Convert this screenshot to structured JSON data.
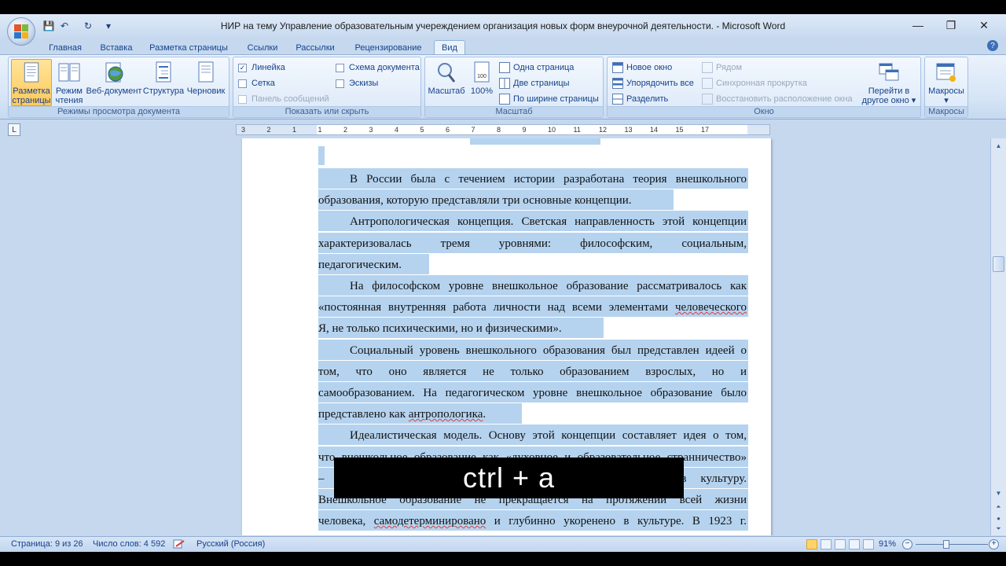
{
  "window": {
    "title": "НИР на тему Управление образовательным учереждением организация новых форм внеурочной деятельности. - Microsoft Word",
    "minimize_glyph": "—",
    "restore_glyph": "❐",
    "close_glyph": "✕"
  },
  "qat": {
    "save": "💾",
    "undo": "↶",
    "redo": "↻",
    "customize": "▾"
  },
  "tabs": [
    {
      "label": "Главная"
    },
    {
      "label": "Вставка"
    },
    {
      "label": "Разметка страницы"
    },
    {
      "label": "Ссылки"
    },
    {
      "label": "Рассылки"
    },
    {
      "label": "Рецензирование"
    },
    {
      "label": "Вид"
    }
  ],
  "active_tab": "Вид",
  "help_glyph": "?",
  "ribbon": {
    "views": {
      "label": "Режимы просмотра документа",
      "buttons": [
        {
          "label1": "Разметка",
          "label2": "страницы",
          "selected": true
        },
        {
          "label1": "Режим",
          "label2": "чтения"
        },
        {
          "label1": "Веб-документ",
          "label2": ""
        },
        {
          "label1": "Структура",
          "label2": ""
        },
        {
          "label1": "Черновик",
          "label2": ""
        }
      ]
    },
    "show": {
      "label": "Показать или скрыть",
      "ruler": "Линейка",
      "grid": "Сетка",
      "message_bar": "Панель сообщений",
      "doc_map": "Схема документа",
      "thumbnails": "Эскизы",
      "check_mark": "✓"
    },
    "zoom": {
      "label": "Масштаб",
      "zoom_btn": "Масштаб",
      "percent_btn": "100%",
      "one_page": "Одна страница",
      "two_pages": "Две страницы",
      "page_width": "По ширине страницы"
    },
    "window": {
      "label": "Окно",
      "new_window": "Новое окно",
      "arrange_all": "Упорядочить все",
      "split": "Разделить",
      "side_by_side": "Рядом",
      "sync_scroll": "Синхронная прокрутка",
      "reset_position": "Восстановить расположение окна",
      "switch1": "Перейти в",
      "switch2": "другое окно ▾"
    },
    "macros": {
      "label": "Макросы",
      "button": "Макросы",
      "arrow": "▾"
    }
  },
  "ruler": {
    "corner": "L",
    "numbers": [
      "3",
      "2",
      "1",
      "1",
      "2",
      "3",
      "4",
      "5",
      "6",
      "7",
      "8",
      "9",
      "10",
      "11",
      "12",
      "13",
      "14",
      "15",
      "17"
    ]
  },
  "document": {
    "lines": [
      {
        "text": "В России была с течением истории разработана теория внешкольного",
        "indent": true,
        "justify": true
      },
      {
        "text": "образования, которую представляли три основные концепции.",
        "indent": false,
        "justify": false
      },
      {
        "text": "Антропологическая концепция. Светская направленность этой концепции",
        "indent": true,
        "justify": true
      },
      {
        "text": "характеризовалась тремя уровнями: философским, социальным,",
        "indent": false,
        "justify": true
      },
      {
        "text": "педагогическим.",
        "indent": false,
        "justify": false
      },
      {
        "text": "На философском уровне внешкольное образование рассматривалось как",
        "indent": true,
        "justify": true
      },
      {
        "text": "«постоянная внутренняя работа личности над всеми элементами человеческого",
        "indent": false,
        "justify": true
      },
      {
        "text": "Я, не только психическими, но и физическими».",
        "indent": false,
        "justify": false
      },
      {
        "text": "Социальный уровень внешкольного образования был представлен идеей о",
        "indent": true,
        "justify": true
      },
      {
        "text": "том, что оно является не только образованием взрослых, но и",
        "indent": false,
        "justify": true
      },
      {
        "text": "самообразованием. На педагогическом уровне внешкольное образование было",
        "indent": false,
        "justify": true
      },
      {
        "text": "представлено как антропологика.",
        "indent": false,
        "justify": false
      },
      {
        "text": "Идеалистическая модель. Основу этой концепции составляет идея о том,",
        "indent": true,
        "justify": true
      },
      {
        "text": "что внешкольное образование как «духовное и образовательное странничество»",
        "indent": false,
        "justify": true
      },
      {
        "text": "– это путь человека к самопознанию через вхождение в культуру.",
        "indent": false,
        "justify": true
      },
      {
        "text": "Внешкольное образование не прекращается на протяжении всей жизни",
        "indent": false,
        "justify": true
      },
      {
        "text": "человека, самодетерминировано и глубинно укоренено в культуре. В 1923 г.",
        "indent": false,
        "justify": true
      }
    ]
  },
  "overlay": {
    "text": "ctrl + a"
  },
  "status": {
    "page": "Страница: 9 из 26",
    "words": "Число слов: 4 592",
    "language": "Русский (Россия)",
    "zoom": "91%",
    "zoom_minus": "−",
    "zoom_plus": "+"
  },
  "colors": {
    "selection": "#b5d3ef",
    "accent": "#15428b",
    "workspace": "#c5d8ee"
  }
}
